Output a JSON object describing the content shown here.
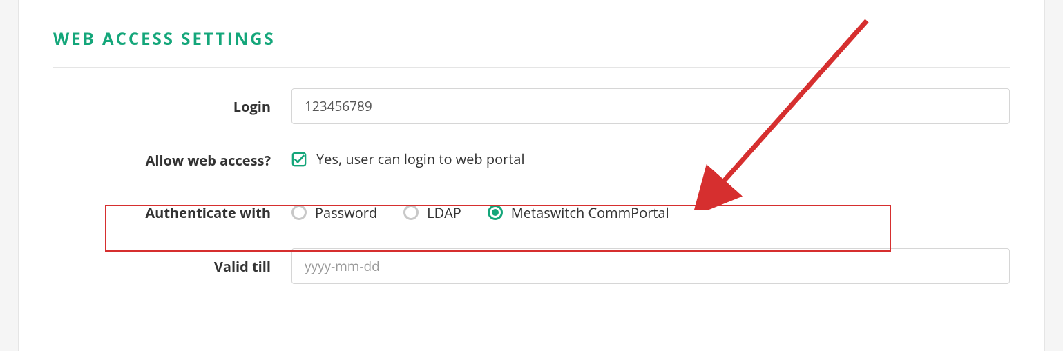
{
  "section_title": "WEB ACCESS SETTINGS",
  "fields": {
    "login": {
      "label": "Login",
      "value": "123456789"
    },
    "allow_web": {
      "label": "Allow web access?",
      "text": "Yes, user can login to web portal",
      "checked": true
    },
    "auth": {
      "label": "Authenticate with",
      "options": {
        "password": "Password",
        "ldap": "LDAP",
        "commportal": "Metaswitch CommPortal"
      },
      "selected": "commportal"
    },
    "valid_till": {
      "label": "Valid till",
      "placeholder": "yyyy-mm-dd",
      "value": ""
    }
  },
  "colors": {
    "accent": "#14a67a",
    "highlight": "#d62f2f"
  }
}
